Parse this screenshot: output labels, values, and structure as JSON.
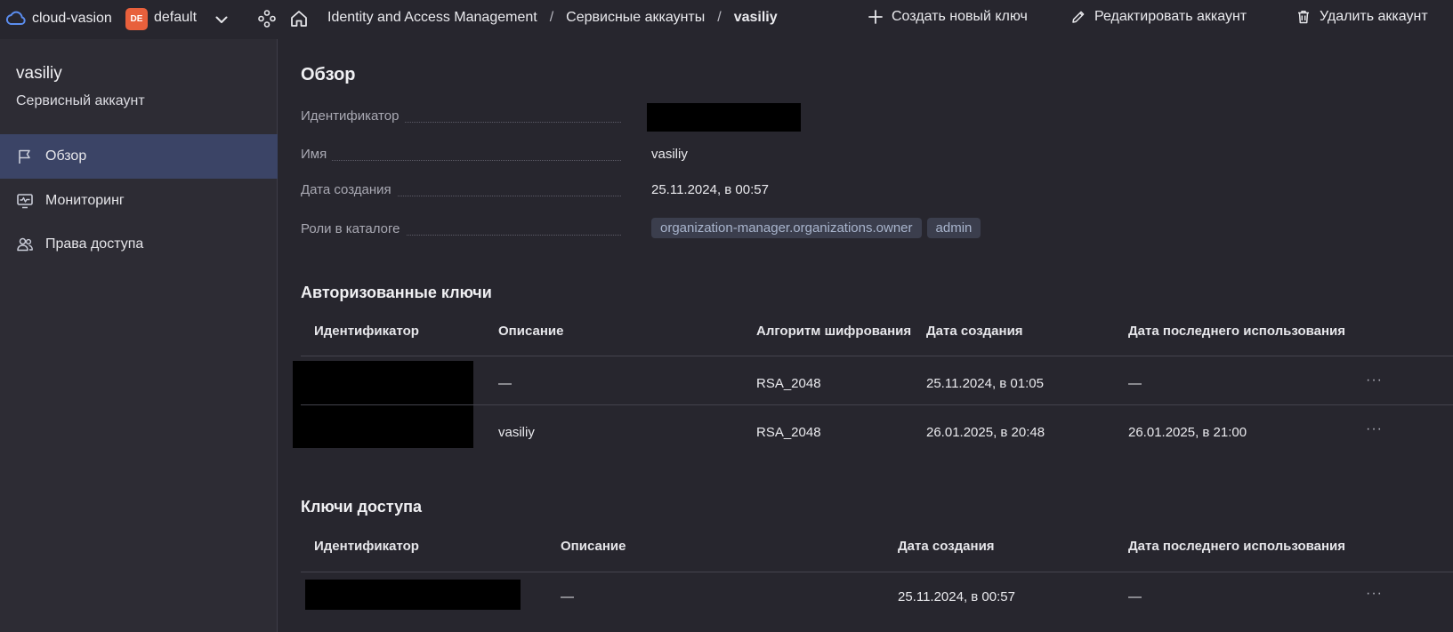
{
  "header": {
    "cloud_name": "cloud-vasion",
    "folder_badge": "DE",
    "folder_name": "default",
    "breadcrumbs": [
      "Identity and Access Management",
      "Сервисные аккаунты",
      "vasiliy"
    ],
    "separator": "/",
    "actions": {
      "create_key": "Создать новый ключ",
      "edit_account": "Редактировать аккаунт",
      "delete_account": "Удалить аккаунт"
    }
  },
  "sidebar": {
    "title": "vasiliy",
    "subtitle": "Сервисный аккаунт",
    "items": [
      {
        "label": "Обзор",
        "icon": "flag-icon",
        "active": true
      },
      {
        "label": "Мониторинг",
        "icon": "monitor-icon",
        "active": false
      },
      {
        "label": "Права доступа",
        "icon": "users-icon",
        "active": false
      }
    ]
  },
  "overview": {
    "title": "Обзор",
    "id_label": "Идентификатор",
    "name_label": "Имя",
    "name_value": "vasiliy",
    "created_label": "Дата создания",
    "created_value": "25.11.2024, в 00:57",
    "roles_label": "Роли в каталоге",
    "roles": [
      "organization-manager.organizations.owner",
      "admin"
    ]
  },
  "auth_keys": {
    "title": "Авторизованные ключи",
    "columns": [
      "Идентификатор",
      "Описание",
      "Алгоритм шифрования",
      "Дата создания",
      "Дата последнего использования"
    ],
    "rows": [
      {
        "description": "—",
        "algorithm": "RSA_2048",
        "created": "25.11.2024, в 01:05",
        "last_used": "—"
      },
      {
        "description": "vasiliy",
        "algorithm": "RSA_2048",
        "created": "26.01.2025, в 20:48",
        "last_used": "26.01.2025, в 21:00"
      }
    ]
  },
  "access_keys": {
    "title": "Ключи доступа",
    "columns": [
      "Идентификатор",
      "Описание",
      "Дата создания",
      "Дата последнего использования"
    ],
    "rows": [
      {
        "description": "—",
        "created": "25.11.2024, в 00:57",
        "last_used": "—"
      }
    ]
  },
  "more_glyph": "···",
  "colors": {
    "background": "#27262e",
    "sidebar": "#2d2c34",
    "active_item": "#3b4466",
    "folder_badge": "#e8603c",
    "cloud_icon": "#5b8def",
    "tag_bg": "#3b3e4d",
    "tag_text": "#a8b4cc"
  }
}
